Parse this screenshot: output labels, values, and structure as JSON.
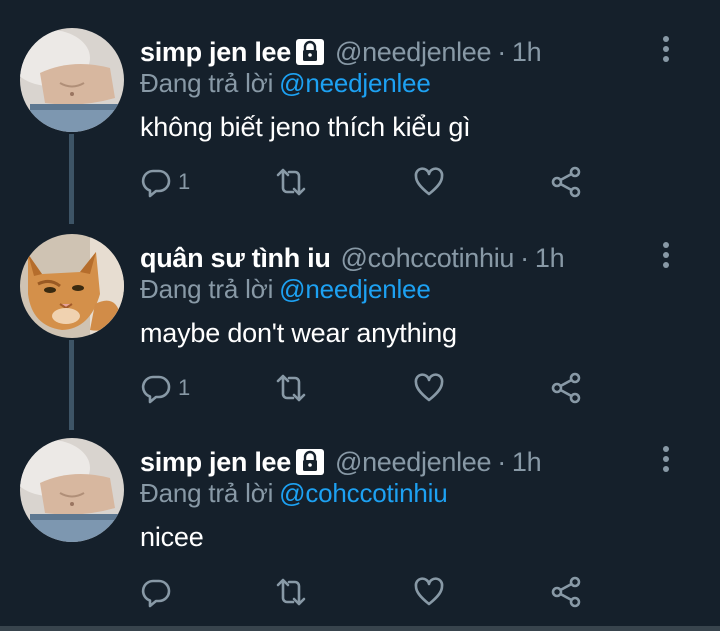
{
  "tweets": [
    {
      "name": "simp jen lee",
      "handle": "@needjenlee",
      "time": "1h",
      "replying_label": "Đang trả lời",
      "replying_to": "@needjenlee",
      "text": "không biết jeno thích kiểu gì",
      "reply_count": "1",
      "protected": true
    },
    {
      "name": "quân sư tình iu",
      "handle": "@cohccotinhiu",
      "time": "1h",
      "replying_label": "Đang trả lời",
      "replying_to": "@needjenlee",
      "text": "maybe don't wear anything",
      "reply_count": "1",
      "protected": false
    },
    {
      "name": "simp jen lee",
      "handle": "@needjenlee",
      "time": "1h",
      "replying_label": "Đang trả lời",
      "replying_to": "@cohccotinhiu",
      "text": "nicee",
      "reply_count": "",
      "protected": true
    }
  ],
  "separator": "·",
  "icons": {
    "reply": "reply-icon",
    "retweet": "retweet-icon",
    "like": "heart-icon",
    "share": "share-icon",
    "more": "more-vertical-icon",
    "lock": "lock-icon"
  },
  "colors": {
    "background": "#15202b",
    "secondary_text": "#8899a6",
    "link": "#1da1f2",
    "thread_line": "#3d5466"
  }
}
